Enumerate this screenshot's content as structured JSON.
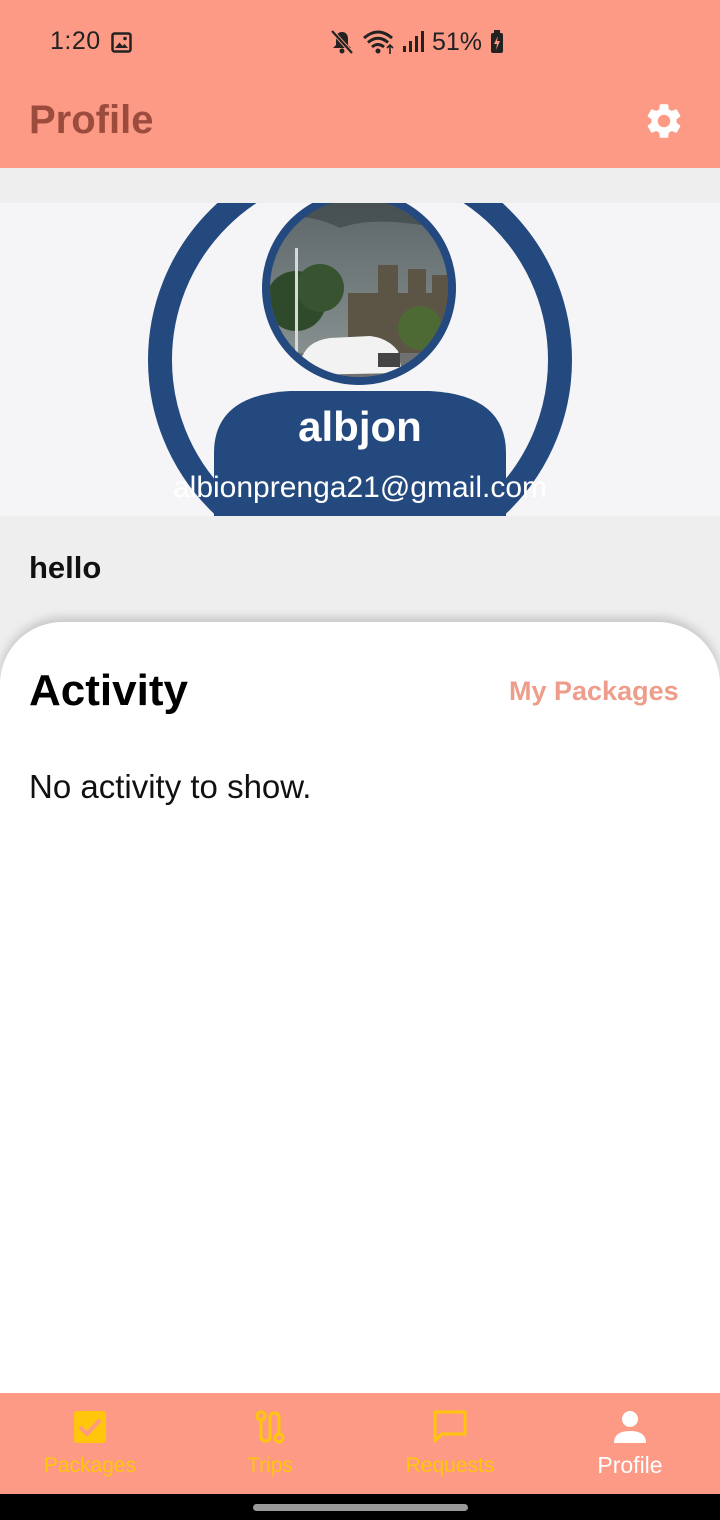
{
  "status_bar": {
    "time": "1:20",
    "battery": "51%",
    "icons": [
      "image-icon",
      "mute-icon",
      "wifi-icon",
      "signal-icon",
      "battery-charging-icon"
    ]
  },
  "app_bar": {
    "title": "Profile",
    "settings_icon": "gear-icon"
  },
  "profile": {
    "name": "albjon",
    "email": "albionprenga21@gmail.com",
    "bio": "hello"
  },
  "activity": {
    "title": "Activity",
    "link_label": "My Packages",
    "empty_message": "No activity to show."
  },
  "bottom_nav": {
    "items": [
      {
        "label": "Packages",
        "icon": "checkbox-icon",
        "active": false
      },
      {
        "label": "Trips",
        "icon": "route-icon",
        "active": false
      },
      {
        "label": "Requests",
        "icon": "chat-bubble-icon",
        "active": false
      },
      {
        "label": "Profile",
        "icon": "person-icon",
        "active": true
      }
    ]
  },
  "colors": {
    "accent": "#fd9a86",
    "title_text": "#9b4c3d",
    "nav_inactive": "#ffc60b",
    "avatar_blue": "#23497e"
  }
}
